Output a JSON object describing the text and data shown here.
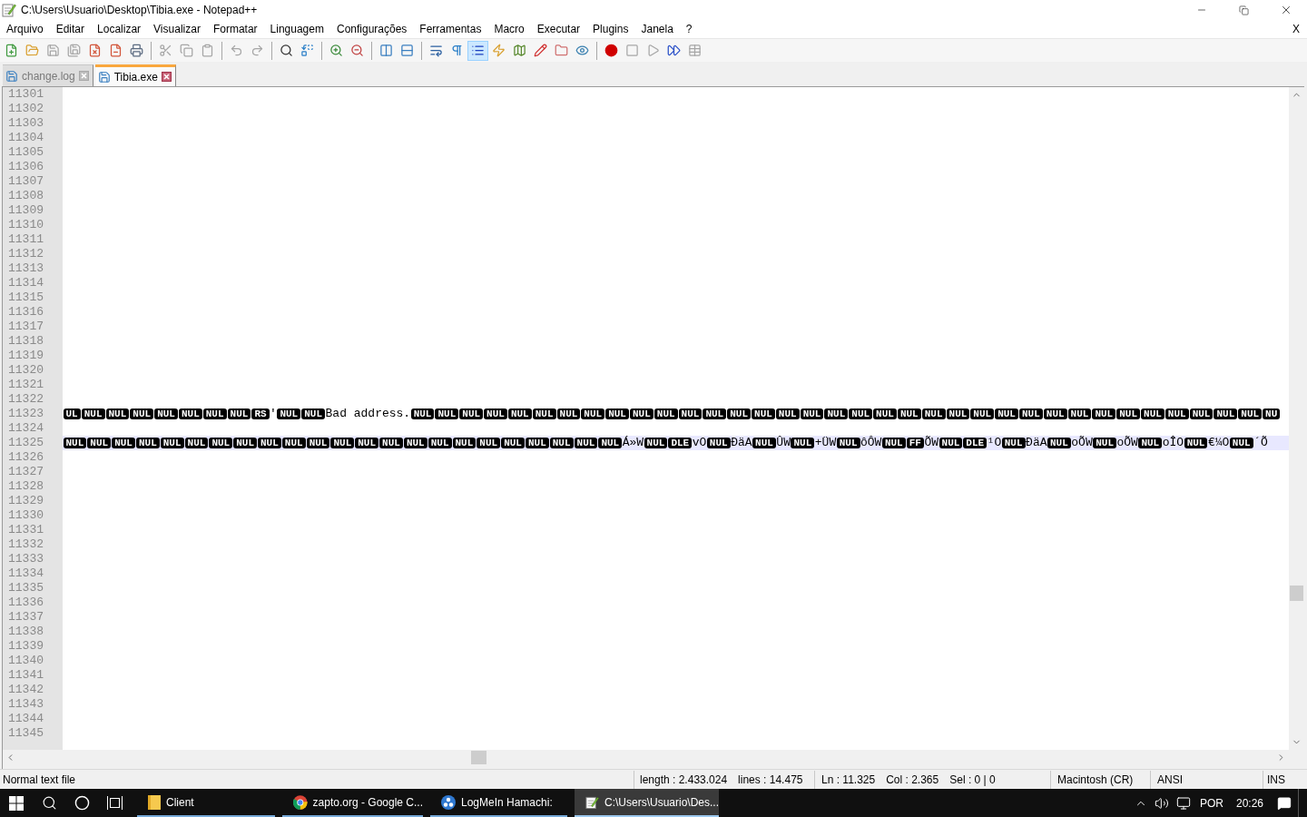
{
  "window": {
    "title": "C:\\Users\\Usuario\\Desktop\\Tibia.exe - Notepad++"
  },
  "menu": {
    "items": [
      "Arquivo",
      "Editar",
      "Localizar",
      "Visualizar",
      "Formatar",
      "Linguagem",
      "Configurações",
      "Ferramentas",
      "Macro",
      "Executar",
      "Plugins",
      "Janela",
      "?"
    ],
    "close_label": "X"
  },
  "toolbar": {
    "groups": [
      {
        "buttons": [
          {
            "kind": "new",
            "disabled": false,
            "pressed": false
          },
          {
            "kind": "open",
            "disabled": false,
            "pressed": false
          },
          {
            "kind": "save",
            "disabled": true,
            "pressed": false
          },
          {
            "kind": "save_all",
            "disabled": true,
            "pressed": false
          },
          {
            "kind": "close",
            "disabled": false,
            "pressed": false
          },
          {
            "kind": "close_all",
            "disabled": false,
            "pressed": false
          },
          {
            "kind": "print",
            "disabled": false,
            "pressed": false
          }
        ]
      },
      {
        "buttons": [
          {
            "kind": "cut",
            "disabled": true,
            "pressed": false
          },
          {
            "kind": "copy",
            "disabled": true,
            "pressed": false
          },
          {
            "kind": "paste",
            "disabled": true,
            "pressed": false
          }
        ]
      },
      {
        "buttons": [
          {
            "kind": "undo",
            "disabled": true,
            "pressed": false
          },
          {
            "kind": "redo",
            "disabled": true,
            "pressed": false
          }
        ]
      },
      {
        "buttons": [
          {
            "kind": "find",
            "disabled": false,
            "pressed": false
          },
          {
            "kind": "replace",
            "disabled": false,
            "pressed": false
          }
        ]
      },
      {
        "buttons": [
          {
            "kind": "zoom_in",
            "disabled": false,
            "pressed": false
          },
          {
            "kind": "zoom_out",
            "disabled": false,
            "pressed": false
          }
        ]
      },
      {
        "buttons": [
          {
            "kind": "sync_v",
            "disabled": false,
            "pressed": false
          },
          {
            "kind": "sync_h",
            "disabled": false,
            "pressed": false
          }
        ]
      },
      {
        "buttons": [
          {
            "kind": "wrap",
            "disabled": false,
            "pressed": false
          },
          {
            "kind": "all_chars",
            "disabled": false,
            "pressed": false
          },
          {
            "kind": "indent_guide",
            "disabled": false,
            "pressed": true
          },
          {
            "kind": "udl",
            "disabled": false,
            "pressed": false
          },
          {
            "kind": "doc_map",
            "disabled": false,
            "pressed": false
          },
          {
            "kind": "func_list",
            "disabled": false,
            "pressed": false
          },
          {
            "kind": "folder_ws",
            "disabled": false,
            "pressed": false
          },
          {
            "kind": "monitor",
            "disabled": false,
            "pressed": false
          }
        ]
      },
      {
        "buttons": [
          {
            "kind": "record",
            "disabled": false,
            "pressed": false
          },
          {
            "kind": "stop",
            "disabled": true,
            "pressed": false
          },
          {
            "kind": "play",
            "disabled": true,
            "pressed": false
          },
          {
            "kind": "play_multi",
            "disabled": false,
            "pressed": false
          },
          {
            "kind": "save_macro",
            "disabled": true,
            "pressed": false
          }
        ]
      }
    ]
  },
  "tabs": [
    {
      "label": "change.log",
      "selected": false
    },
    {
      "label": "Tibia.exe",
      "selected": true
    }
  ],
  "editor": {
    "lines": [
      {
        "number": "11301",
        "current": false
      },
      {
        "number": "11302",
        "current": false
      },
      {
        "number": "11303",
        "current": false
      },
      {
        "number": "11304",
        "current": false
      },
      {
        "number": "11305",
        "current": false
      },
      {
        "number": "11306",
        "current": false
      },
      {
        "number": "11307",
        "current": false
      },
      {
        "number": "11308",
        "current": false
      },
      {
        "number": "11309",
        "current": false
      },
      {
        "number": "11310",
        "current": false
      },
      {
        "number": "11311",
        "current": false
      },
      {
        "number": "11312",
        "current": false
      },
      {
        "number": "11313",
        "current": false
      },
      {
        "number": "11314",
        "current": false
      },
      {
        "number": "11315",
        "current": false
      },
      {
        "number": "11316",
        "current": false
      },
      {
        "number": "11317",
        "current": false
      },
      {
        "number": "11318",
        "current": false
      },
      {
        "number": "11319",
        "current": false
      },
      {
        "number": "11320",
        "current": false
      },
      {
        "number": "11321",
        "current": false
      },
      {
        "number": "11322",
        "current": false
      },
      {
        "number": "11323",
        "current": false,
        "tokens": [
          {
            "kind": "ctrl",
            "text": "UL"
          },
          {
            "kind": "ctrl",
            "text": "NUL"
          },
          {
            "kind": "ctrl",
            "text": "NUL"
          },
          {
            "kind": "ctrl",
            "text": "NUL"
          },
          {
            "kind": "ctrl",
            "text": "NUL"
          },
          {
            "kind": "ctrl",
            "text": "NUL"
          },
          {
            "kind": "ctrl",
            "text": "NUL"
          },
          {
            "kind": "ctrl",
            "text": "NUL"
          },
          {
            "kind": "ctrl",
            "text": "RS"
          },
          {
            "kind": "text",
            "text": "'"
          },
          {
            "kind": "ctrl",
            "text": "NUL"
          },
          {
            "kind": "ctrl",
            "text": "NUL"
          },
          {
            "kind": "text",
            "text": "Bad address."
          },
          {
            "kind": "ctrl",
            "text": "NUL"
          },
          {
            "kind": "ctrl",
            "text": "NUL"
          },
          {
            "kind": "ctrl",
            "text": "NUL"
          },
          {
            "kind": "ctrl",
            "text": "NUL"
          },
          {
            "kind": "ctrl",
            "text": "NUL"
          },
          {
            "kind": "ctrl",
            "text": "NUL"
          },
          {
            "kind": "ctrl",
            "text": "NUL"
          },
          {
            "kind": "ctrl",
            "text": "NUL"
          },
          {
            "kind": "ctrl",
            "text": "NUL"
          },
          {
            "kind": "ctrl",
            "text": "NUL"
          },
          {
            "kind": "ctrl",
            "text": "NUL"
          },
          {
            "kind": "ctrl",
            "text": "NUL"
          },
          {
            "kind": "ctrl",
            "text": "NUL"
          },
          {
            "kind": "ctrl",
            "text": "NUL"
          },
          {
            "kind": "ctrl",
            "text": "NUL"
          },
          {
            "kind": "ctrl",
            "text": "NUL"
          },
          {
            "kind": "ctrl",
            "text": "NUL"
          },
          {
            "kind": "ctrl",
            "text": "NUL"
          },
          {
            "kind": "ctrl",
            "text": "NUL"
          },
          {
            "kind": "ctrl",
            "text": "NUL"
          },
          {
            "kind": "ctrl",
            "text": "NUL"
          },
          {
            "kind": "ctrl",
            "text": "NUL"
          },
          {
            "kind": "ctrl",
            "text": "NUL"
          },
          {
            "kind": "ctrl",
            "text": "NUL"
          },
          {
            "kind": "ctrl",
            "text": "NUL"
          },
          {
            "kind": "ctrl",
            "text": "NUL"
          },
          {
            "kind": "ctrl",
            "text": "NUL"
          },
          {
            "kind": "ctrl",
            "text": "NUL"
          },
          {
            "kind": "ctrl",
            "text": "NUL"
          },
          {
            "kind": "ctrl",
            "text": "NUL"
          },
          {
            "kind": "ctrl",
            "text": "NUL"
          },
          {
            "kind": "ctrl",
            "text": "NUL"
          },
          {
            "kind": "ctrl",
            "text": "NUL"
          },
          {
            "kind": "ctrl",
            "text": "NUL"
          },
          {
            "kind": "ctrl",
            "text": "NUL"
          },
          {
            "kind": "ctrl",
            "text": "NU"
          }
        ]
      },
      {
        "number": "11324",
        "current": false
      },
      {
        "number": "11325",
        "current": true,
        "tokens": [
          {
            "kind": "ctrl",
            "text": "NUL"
          },
          {
            "kind": "ctrl",
            "text": "NUL"
          },
          {
            "kind": "ctrl",
            "text": "NUL"
          },
          {
            "kind": "ctrl",
            "text": "NUL"
          },
          {
            "kind": "ctrl",
            "text": "NUL"
          },
          {
            "kind": "ctrl",
            "text": "NUL"
          },
          {
            "kind": "ctrl",
            "text": "NUL"
          },
          {
            "kind": "ctrl",
            "text": "NUL"
          },
          {
            "kind": "ctrl",
            "text": "NUL"
          },
          {
            "kind": "ctrl",
            "text": "NUL"
          },
          {
            "kind": "ctrl",
            "text": "NUL"
          },
          {
            "kind": "ctrl",
            "text": "NUL"
          },
          {
            "kind": "ctrl",
            "text": "NUL"
          },
          {
            "kind": "ctrl",
            "text": "NUL"
          },
          {
            "kind": "ctrl",
            "text": "NUL"
          },
          {
            "kind": "ctrl",
            "text": "NUL"
          },
          {
            "kind": "ctrl",
            "text": "NUL"
          },
          {
            "kind": "ctrl",
            "text": "NUL"
          },
          {
            "kind": "ctrl",
            "text": "NUL"
          },
          {
            "kind": "ctrl",
            "text": "NUL"
          },
          {
            "kind": "ctrl",
            "text": "NUL"
          },
          {
            "kind": "ctrl",
            "text": "NUL"
          },
          {
            "kind": "ctrl",
            "text": "NUL"
          },
          {
            "kind": "text",
            "text": "Á»W"
          },
          {
            "kind": "ctrl",
            "text": "NUL"
          },
          {
            "kind": "ctrl",
            "text": "DLE"
          },
          {
            "kind": "text",
            "text": "vO"
          },
          {
            "kind": "ctrl",
            "text": "NUL"
          },
          {
            "kind": "text",
            "text": "ÐäA"
          },
          {
            "kind": "ctrl",
            "text": "NUL"
          },
          {
            "kind": "text",
            "text": "ÛW"
          },
          {
            "kind": "ctrl",
            "text": "NUL"
          },
          {
            "kind": "text",
            "text": "+ÜW"
          },
          {
            "kind": "ctrl",
            "text": "NUL"
          },
          {
            "kind": "text",
            "text": "ôÔW"
          },
          {
            "kind": "ctrl",
            "text": "NUL"
          },
          {
            "kind": "ctrl",
            "text": "FF"
          },
          {
            "kind": "text",
            "text": "ÕW"
          },
          {
            "kind": "ctrl",
            "text": "NUL"
          },
          {
            "kind": "ctrl",
            "text": "DLE"
          },
          {
            "kind": "text",
            "text": "¹O"
          },
          {
            "kind": "ctrl",
            "text": "NUL"
          },
          {
            "kind": "text",
            "text": "ÐäA"
          },
          {
            "kind": "ctrl",
            "text": "NUL"
          },
          {
            "kind": "text",
            "text": "oÕW"
          },
          {
            "kind": "ctrl",
            "text": "NUL"
          },
          {
            "kind": "text",
            "text": "oÕW"
          },
          {
            "kind": "ctrl",
            "text": "NUL"
          },
          {
            "kind": "text",
            "text": "oÎO"
          },
          {
            "kind": "ctrl",
            "text": "NUL"
          },
          {
            "kind": "text",
            "text": "€¼O"
          },
          {
            "kind": "ctrl",
            "text": "NUL"
          },
          {
            "kind": "text",
            "text": "´Õ"
          }
        ]
      },
      {
        "number": "11326",
        "current": false
      },
      {
        "number": "11327",
        "current": false
      },
      {
        "number": "11328",
        "current": false
      },
      {
        "number": "11329",
        "current": false
      },
      {
        "number": "11330",
        "current": false
      },
      {
        "number": "11331",
        "current": false
      },
      {
        "number": "11332",
        "current": false
      },
      {
        "number": "11333",
        "current": false
      },
      {
        "number": "11334",
        "current": false
      },
      {
        "number": "11335",
        "current": false
      },
      {
        "number": "11336",
        "current": false
      },
      {
        "number": "11337",
        "current": false
      },
      {
        "number": "11338",
        "current": false
      },
      {
        "number": "11339",
        "current": false
      },
      {
        "number": "11340",
        "current": false
      },
      {
        "number": "11341",
        "current": false
      },
      {
        "number": "11342",
        "current": false
      },
      {
        "number": "11343",
        "current": false
      },
      {
        "number": "11344",
        "current": false
      },
      {
        "number": "11345",
        "current": false
      }
    ]
  },
  "status_bar": {
    "sections": [
      {
        "items": [
          "Normal text file"
        ]
      },
      {
        "items": [
          "length : 2.433.024",
          "lines : 14.475"
        ]
      },
      {
        "items": [
          "Ln : 11.325",
          "Col : 2.365",
          "Sel : 0 | 0"
        ]
      },
      {
        "items": [
          "Macintosh (CR)"
        ]
      },
      {
        "items": [
          "ANSI"
        ]
      },
      {
        "items": [
          "INS"
        ]
      }
    ]
  },
  "taskbar": {
    "apps": [
      {
        "kind": "folder",
        "label": "Client",
        "selected": false
      },
      {
        "kind": "browser",
        "label": "zapto.org - Google C...",
        "selected": false
      },
      {
        "kind": "network",
        "label": "LogMeIn Hamachi:",
        "selected": false
      },
      {
        "kind": "notepad",
        "label": "C:\\Users\\Usuario\\Des...",
        "selected": true
      }
    ],
    "language": "POR",
    "time": "20:26"
  }
}
